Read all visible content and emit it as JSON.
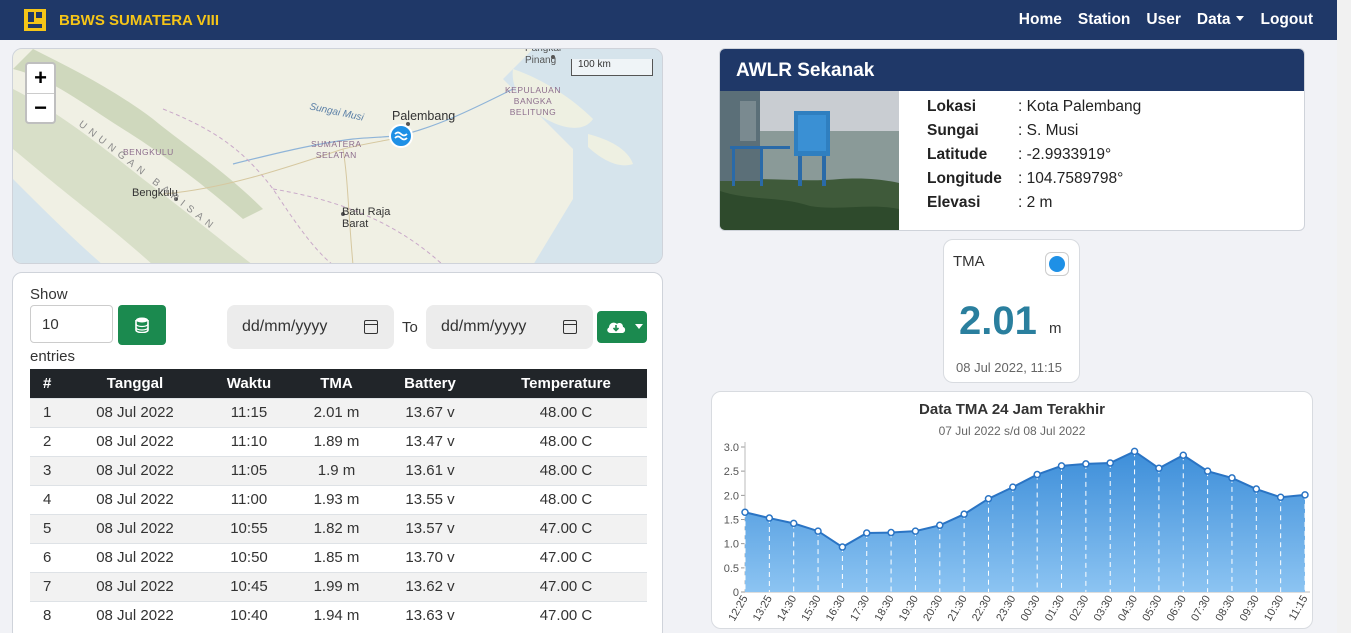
{
  "navbar": {
    "brand": "BBWS SUMATERA VIII",
    "links": [
      "Home",
      "Station",
      "User",
      "Data",
      "Logout"
    ]
  },
  "map": {
    "zoom_in": "+",
    "zoom_out": "−",
    "scale": "100 km",
    "labels": {
      "pangkal_pinang": "Pangkal\nPinang",
      "kepulauan": "KEPULAUAN\nBANGKA\nBELITUNG",
      "palembang": "Palembang",
      "sungai_musi": "Sungai Musi",
      "sumsel": "SUMATERA\nSELATAN",
      "bengkulu_region": "BENGKULU",
      "bengkulu_city": "Bengkulu",
      "baturaja": "Batu Raja\nBarat",
      "mountains": "UNUNGAN BARISAN"
    }
  },
  "table": {
    "show_label": "Show",
    "entries_value": "10",
    "entries_label": "entries",
    "date_from_placeholder": "dd/mm/yyyy",
    "to_label": "To",
    "date_to_placeholder": "dd/mm/yyyy",
    "headers": [
      "#",
      "Tanggal",
      "Waktu",
      "TMA",
      "Battery",
      "Temperature"
    ],
    "rows": [
      [
        "1",
        "08 Jul 2022",
        "11:15",
        "2.01 m",
        "13.67 v",
        "48.00 C"
      ],
      [
        "2",
        "08 Jul 2022",
        "11:10",
        "1.89 m",
        "13.47 v",
        "48.00 C"
      ],
      [
        "3",
        "08 Jul 2022",
        "11:05",
        "1.9 m",
        "13.61 v",
        "48.00 C"
      ],
      [
        "4",
        "08 Jul 2022",
        "11:00",
        "1.93 m",
        "13.55 v",
        "48.00 C"
      ],
      [
        "5",
        "08 Jul 2022",
        "10:55",
        "1.82 m",
        "13.57 v",
        "47.00 C"
      ],
      [
        "6",
        "08 Jul 2022",
        "10:50",
        "1.85 m",
        "13.70 v",
        "47.00 C"
      ],
      [
        "7",
        "08 Jul 2022",
        "10:45",
        "1.99 m",
        "13.62 v",
        "47.00 C"
      ],
      [
        "8",
        "08 Jul 2022",
        "10:40",
        "1.94 m",
        "13.63 v",
        "47.00 C"
      ]
    ]
  },
  "station": {
    "title": "AWLR Sekanak",
    "info": [
      {
        "key": "Lokasi",
        "value": ": Kota Palembang"
      },
      {
        "key": "Sungai",
        "value": ": S. Musi"
      },
      {
        "key": "Latitude",
        "value": ": -2.9933919°"
      },
      {
        "key": "Longitude",
        "value": ": 104.7589798°"
      },
      {
        "key": "Elevasi",
        "value": ": 2 m"
      }
    ]
  },
  "tma": {
    "label": "TMA",
    "value": "2.01",
    "unit": "m",
    "time": "08 Jul 2022, 11:15"
  },
  "chart_data": {
    "type": "area",
    "title": "Data TMA 24 Jam Terakhir",
    "subtitle": "07 Jul 2022 s/d 08 Jul 2022",
    "ylim": [
      0,
      3.0
    ],
    "yticks": [
      "0",
      "0.5",
      "1.0",
      "1.5",
      "2.0",
      "2.5",
      "3.0"
    ],
    "categories": [
      "12:25",
      "13:25",
      "14:30",
      "15:30",
      "16:30",
      "17:30",
      "18:30",
      "19:30",
      "20:30",
      "21:30",
      "22:30",
      "23:30",
      "00:30",
      "01:30",
      "02:30",
      "03:30",
      "04:30",
      "05:30",
      "06:30",
      "07:30",
      "08:30",
      "09:30",
      "10:30",
      "11:15"
    ],
    "values": [
      1.65,
      1.53,
      1.42,
      1.26,
      0.93,
      1.22,
      1.23,
      1.26,
      1.38,
      1.61,
      1.93,
      2.17,
      2.43,
      2.61,
      2.65,
      2.67,
      2.91,
      2.56,
      2.83,
      2.5,
      2.36,
      2.13,
      1.96,
      2.01
    ],
    "colors": {
      "fill": "#5aa6e6",
      "line": "#2a74c4"
    }
  }
}
